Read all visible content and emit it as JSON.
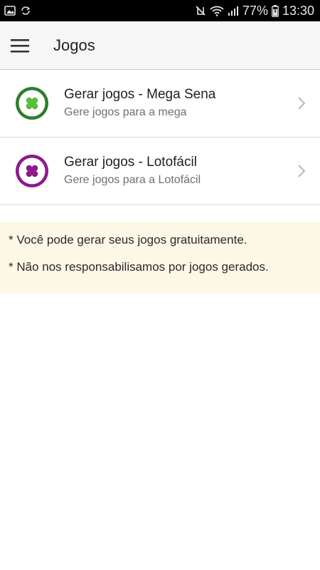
{
  "status_bar": {
    "battery": "77%",
    "time": "13:30",
    "icons": [
      "image-icon",
      "sync-icon",
      "mute-vibrate-icon",
      "wifi-icon",
      "signal-icon",
      "battery-icon"
    ]
  },
  "app_bar": {
    "menu_icon": "hamburger-menu-icon",
    "title": "Jogos"
  },
  "games": [
    {
      "title": "Gerar jogos - Mega Sena",
      "subtitle": "Gere jogos para a mega",
      "icon": "clover-icon",
      "color": "#2e7d2e",
      "accent": "#5dbb3a"
    },
    {
      "title": "Gerar jogos - Lotofácil",
      "subtitle": "Gere jogos para a Lotofácil",
      "icon": "clover-icon",
      "color": "#8b1a8b",
      "accent": "#8b1a8b"
    }
  ],
  "notice": {
    "background": "#fdf7e6",
    "lines": [
      "* Você pode gerar seus jogos gratuitamente.",
      "* Não nos responsabilisamos por jogos gerados."
    ]
  }
}
